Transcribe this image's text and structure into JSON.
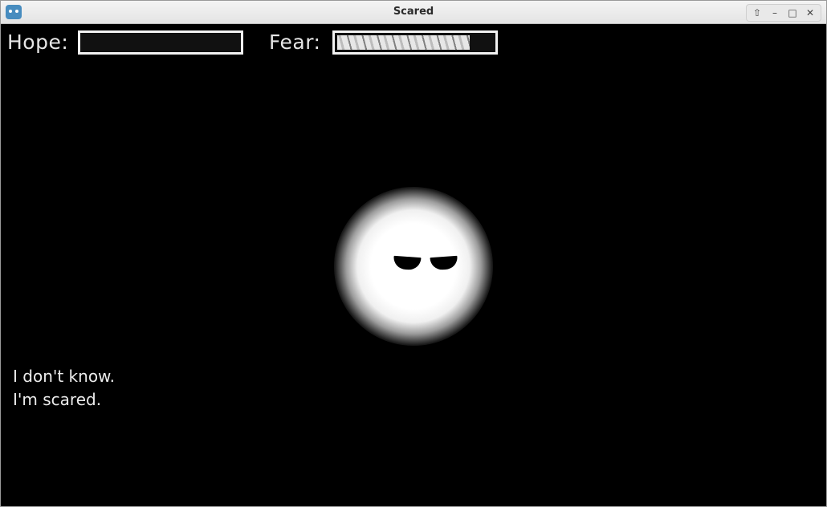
{
  "window": {
    "title": "Scared",
    "icon": "godot-icon",
    "controls": [
      "shade-icon",
      "minimize-icon",
      "maximize-icon",
      "close-icon"
    ]
  },
  "hud": {
    "hope_label": "Hope:",
    "hope_level": 0.0,
    "fear_label": "Fear:",
    "fear_level": 0.85
  },
  "character": {
    "expression": "sad"
  },
  "dialogue": {
    "lines": [
      "I don't know.",
      "I'm scared."
    ]
  },
  "colors": {
    "background": "#000000",
    "text": "#ececec",
    "orb": "#ffffff",
    "bar_border": "#f2f2f2"
  }
}
